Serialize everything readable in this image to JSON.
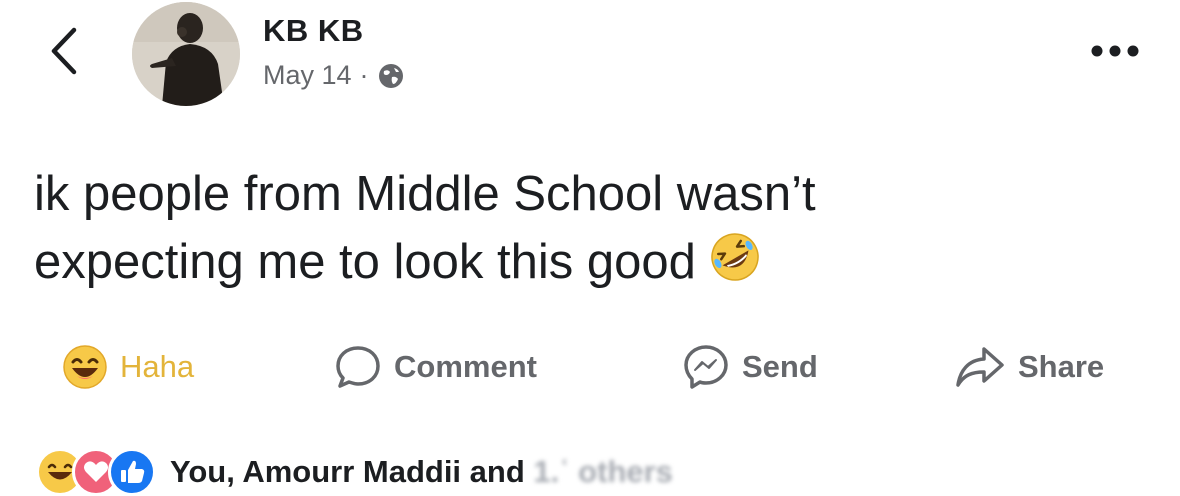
{
  "post": {
    "author_name": "KB KB",
    "date": "May 14",
    "separator": "·",
    "privacy_icon": "globe-icon",
    "text_line1": "ik people from Middle School wasn’t",
    "text_line2": "expecting me to look this good",
    "inline_emoji": "rolling-on-floor-laughing-emoji"
  },
  "actions": {
    "haha_label": "Haha",
    "comment_label": "Comment",
    "send_label": "Send",
    "share_label": "Share"
  },
  "reactions": {
    "icons": [
      "haha-reaction-icon",
      "love-reaction-icon",
      "like-reaction-icon"
    ],
    "summary": "You, Amourr Maddii and ",
    "summary_obscured": "1.ʿ others"
  },
  "colors": {
    "haha_yellow": "#f5c33b",
    "love_pink": "#f0617a",
    "like_blue": "#1877f2",
    "muted_text": "#65676b",
    "primary_text": "#1c1e21"
  }
}
